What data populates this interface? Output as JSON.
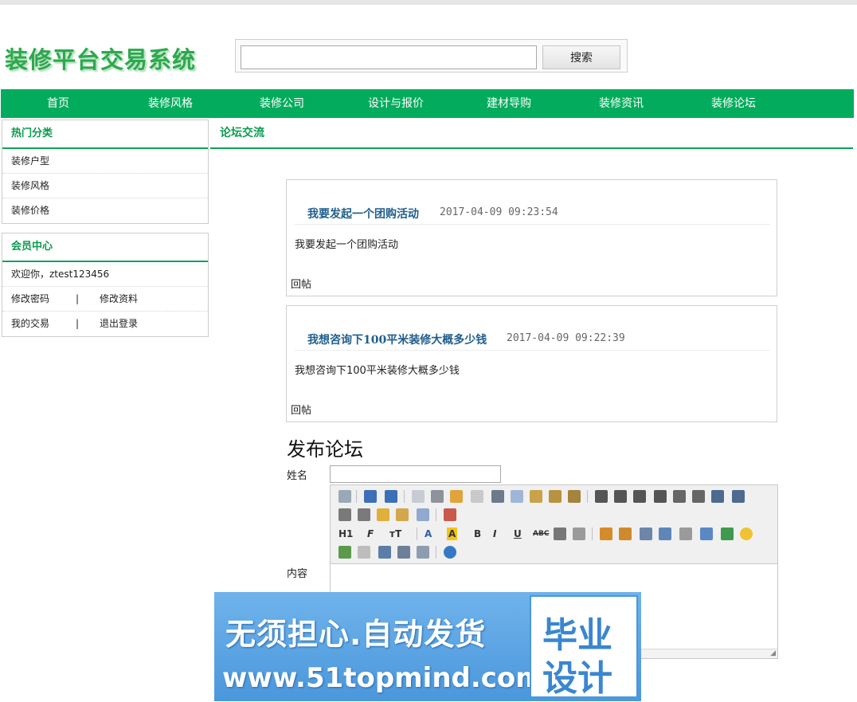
{
  "site": {
    "logo_text": "装修平台交易系统"
  },
  "search": {
    "value": "",
    "button_label": "搜索"
  },
  "nav": {
    "items": [
      "首页",
      "装修风格",
      "装修公司",
      "设计与报价",
      "建材导购",
      "装修资讯",
      "装修论坛"
    ]
  },
  "hot_categories": {
    "title": "热门分类",
    "items": [
      "装修户型",
      "装修风格",
      "装修价格"
    ]
  },
  "member_center": {
    "title": "会员中心",
    "welcome": "欢迎你，ztest123456",
    "change_password": "修改密码",
    "separator": "|",
    "edit_profile": "修改资料",
    "my_trades": "我的交易",
    "logout": "退出登录"
  },
  "main": {
    "title": "论坛交流"
  },
  "posts": [
    {
      "title": "我要发起一个团购活动",
      "time": "2017-04-09 09:23:54",
      "body": "我要发起一个团购活动",
      "reply_label": "回帖"
    },
    {
      "title": "我想咨询下100平米装修大概多少钱",
      "time": "2017-04-09 09:22:39",
      "body": "我想咨询下100平米装修大概多少钱",
      "reply_label": "回帖"
    }
  ],
  "publish": {
    "heading": "发布论坛",
    "name_label": "姓名",
    "name_value": "",
    "content_label": "内容"
  },
  "editor_toolbar": {
    "heading_label": "H1",
    "font_family_label": "F",
    "font_size_label": "тT",
    "font_color_label": "A",
    "bg_color_label": "A",
    "bold_label": "B",
    "italic_label": "I",
    "underline_label": "U",
    "strike_label": "ABC"
  },
  "watermark": {
    "line1": "无须担心.自动发货",
    "line2": "www.51topmind.com",
    "badge_line1": "毕业",
    "badge_line2": "设计"
  },
  "colors": {
    "brand_green": "#02ac5c",
    "title_green": "#0a9b4f",
    "post_title_blue": "#1f5e8c"
  }
}
